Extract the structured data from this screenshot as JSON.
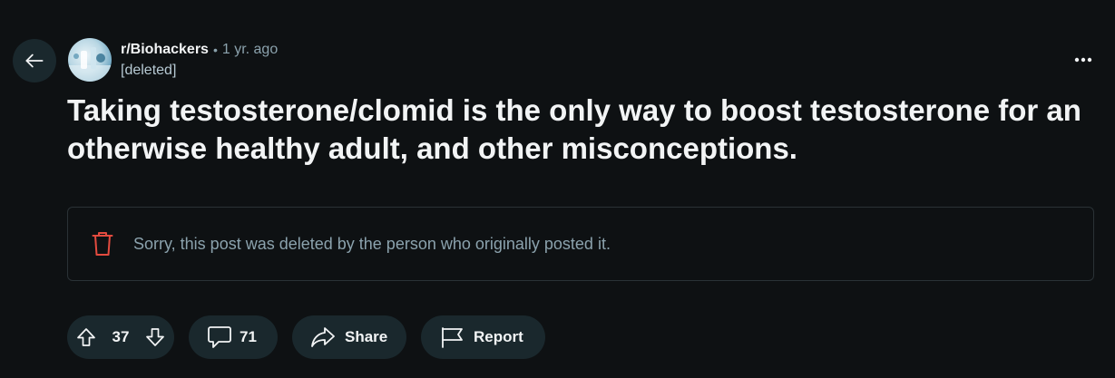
{
  "header": {
    "subreddit": "r/Biohackers",
    "separator": "•",
    "time_ago": "1 yr. ago",
    "author": "[deleted]"
  },
  "post": {
    "title": "Taking testosterone/clomid is the only way to boost testosterone for an otherwise healthy adult, and other misconceptions.",
    "deleted_message": "Sorry, this post was deleted by the person who originally posted it."
  },
  "actions": {
    "vote_count": "37",
    "comment_count": "71",
    "share_label": "Share",
    "report_label": "Report"
  },
  "icons": {
    "back": "arrow-left-icon",
    "overflow": "more-horizontal-icon",
    "trash": "trash-icon",
    "upvote": "arrow-up-icon",
    "downvote": "arrow-down-icon",
    "comment": "comment-icon",
    "share": "share-icon",
    "report": "flag-icon"
  },
  "colors": {
    "background": "#0e1113",
    "button_bg": "#1a282d",
    "trash_red": "#e34b3f",
    "muted_text": "#8ba2ad"
  }
}
